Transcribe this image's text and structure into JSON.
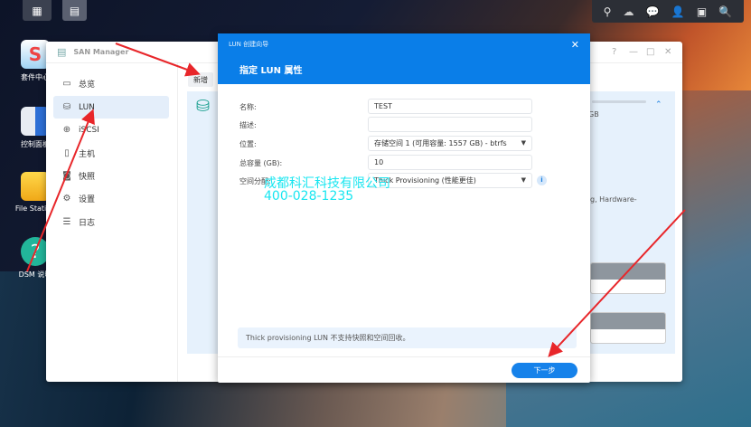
{
  "desktop": {
    "icons": [
      {
        "label": "套件中心"
      },
      {
        "label": "控制面板"
      },
      {
        "label": "File Station"
      },
      {
        "label": "DSM 说明"
      }
    ]
  },
  "taskbar": {
    "tray_icons": [
      "search-task-icon",
      "cloud-sync-icon",
      "chat-icon",
      "user-icon",
      "widgets-icon",
      "search-icon"
    ]
  },
  "window": {
    "title": "SAN Manager",
    "help": "?",
    "minimize": "—",
    "maximize": "□",
    "close": "✕",
    "sidebar": [
      {
        "label": "总览",
        "icon": "overview-icon"
      },
      {
        "label": "LUN",
        "icon": "lun-icon",
        "selected": true
      },
      {
        "label": "iSCSI",
        "icon": "globe-icon"
      },
      {
        "label": "主机",
        "icon": "host-icon"
      },
      {
        "label": "快照",
        "icon": "camera-icon"
      },
      {
        "label": "设置",
        "icon": "gear-icon"
      },
      {
        "label": "日志",
        "icon": "list-icon"
      }
    ],
    "toolbar": {
      "add_label": "新增"
    },
    "panel": {
      "size_suffix": "GB",
      "features_fragment": "g, Hardware-"
    }
  },
  "dialog": {
    "wizard_title": "LUN 创建向导",
    "step_title": "指定 LUN 属性",
    "close": "✕",
    "fields": [
      {
        "label": "名称:",
        "value": "TEST"
      },
      {
        "label": "描述:",
        "value": ""
      },
      {
        "label": "位置:",
        "value": "存储空间 1 (可用容量: 1557 GB) - btrfs"
      },
      {
        "label": "总容量 (GB):",
        "value": "10"
      },
      {
        "label": "空间分配:",
        "value": "Thick Provisioning (性能更佳)"
      }
    ],
    "note": "Thick provisioning LUN 不支持快照和空间回收。",
    "next_label": "下一步"
  },
  "watermark": {
    "line1": "成都科汇科技有限公司",
    "line2": "400-028-1235"
  },
  "colors": {
    "accent": "#0a7ee8",
    "annotation": "#e8262a",
    "watermark": "#19e6f0"
  }
}
